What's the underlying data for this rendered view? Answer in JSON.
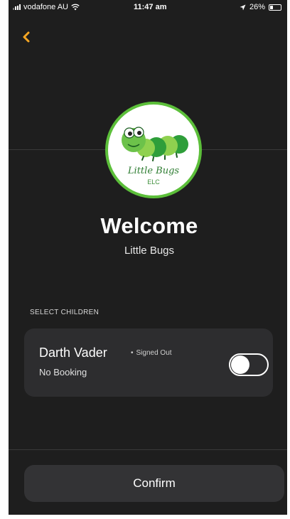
{
  "status_bar": {
    "carrier": "vodafone AU",
    "time": "11:47 am",
    "battery": "26%",
    "battery_level": 0.26,
    "icons": [
      "signal-icon",
      "wifi-icon",
      "location-arrow-icon",
      "battery-icon"
    ]
  },
  "nav": {
    "back_icon": "chevron-left-icon",
    "accent_color": "#f5a623"
  },
  "logo": {
    "title": "Little Bugs",
    "subtitle": "ELC",
    "border_color": "#5cbf3a"
  },
  "welcome": {
    "title": "Welcome",
    "subtitle": "Little Bugs"
  },
  "children_section": {
    "label": "SELECT CHILDREN",
    "children": [
      {
        "name": "Darth Vader",
        "status": "Signed Out",
        "booking": "No Booking",
        "selected": false
      }
    ]
  },
  "footer": {
    "confirm_label": "Confirm"
  }
}
